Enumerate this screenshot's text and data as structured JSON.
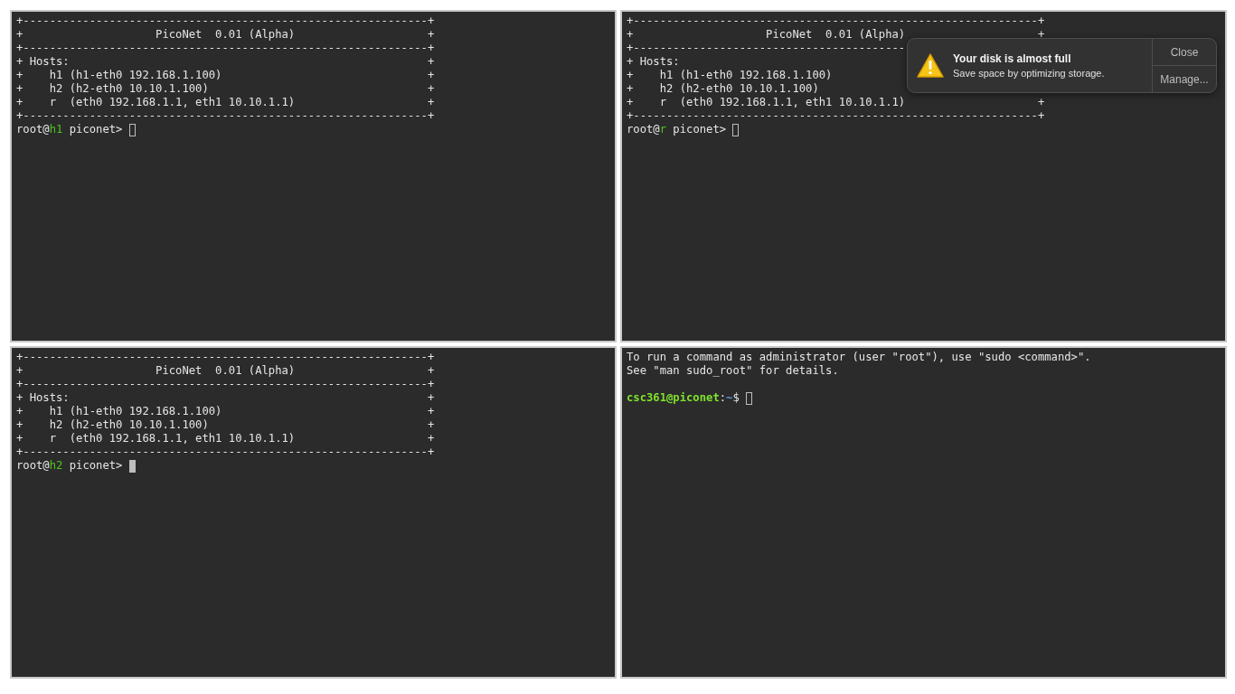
{
  "panes": [
    {
      "kind": "picnet",
      "focused": false,
      "lines": [
        "+-------------------------------------------------------------+",
        "+                    PicoNet  0.01 (Alpha)                    +",
        "+-------------------------------------------------------------+",
        "+ Hosts:                                                      +",
        "+    h1 (h1-eth0 192.168.1.100)                               +",
        "+    h2 (h2-eth0 10.10.1.100)                                 +",
        "+    r  (eth0 192.168.1.1, eth1 10.10.1.1)                    +",
        "+-------------------------------------------------------------+"
      ],
      "prompt": [
        {
          "text": "root@",
          "kind": "plain"
        },
        {
          "text": "h1",
          "kind": "host"
        },
        {
          "text": " piconet> ",
          "kind": "plain"
        }
      ]
    },
    {
      "kind": "picnet",
      "focused": false,
      "lines": [
        "+-------------------------------------------------------------+",
        "+                    PicoNet  0.01 (Alpha)                    +",
        "+-----------------------------------------",
        "+ Hosts:",
        "+    h1 (h1-eth0 192.168.1.100)",
        "+    h2 (h2-eth0 10.10.1.100)",
        "+    r  (eth0 192.168.1.1, eth1 10.10.1.1)                    +",
        "+-------------------------------------------------------------+"
      ],
      "prompt": [
        {
          "text": "root@",
          "kind": "plain"
        },
        {
          "text": "r",
          "kind": "host"
        },
        {
          "text": " piconet> ",
          "kind": "plain"
        }
      ],
      "notification": {
        "title": "Your disk is almost full",
        "message": "Save space by optimizing storage.",
        "buttons": [
          "Close",
          "Manage..."
        ]
      }
    },
    {
      "kind": "picnet",
      "focused": true,
      "lines": [
        "+-------------------------------------------------------------+",
        "+                    PicoNet  0.01 (Alpha)                    +",
        "+-------------------------------------------------------------+",
        "+ Hosts:                                                      +",
        "+    h1 (h1-eth0 192.168.1.100)                               +",
        "+    h2 (h2-eth0 10.10.1.100)                                 +",
        "+    r  (eth0 192.168.1.1, eth1 10.10.1.1)                    +",
        "+-------------------------------------------------------------+"
      ],
      "prompt": [
        {
          "text": "root@",
          "kind": "plain"
        },
        {
          "text": "h2",
          "kind": "host"
        },
        {
          "text": " piconet> ",
          "kind": "plain"
        }
      ]
    },
    {
      "kind": "shell",
      "focused": false,
      "lines": [
        "To run a command as administrator (user \"root\"), use \"sudo <command>\".",
        "See \"man sudo_root\" for details."
      ],
      "prompt": [
        {
          "text": "csc361@piconet",
          "kind": "user"
        },
        {
          "text": ":",
          "kind": "plain"
        },
        {
          "text": "~",
          "kind": "path"
        },
        {
          "text": "$ ",
          "kind": "plain"
        }
      ]
    }
  ]
}
